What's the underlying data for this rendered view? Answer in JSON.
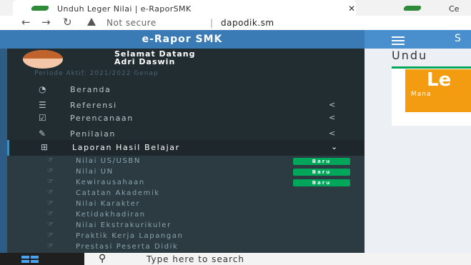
{
  "browser": {
    "tab_title": "Unduh Leger Nilai | e-RaporSMK",
    "tab_close": "✕",
    "tab2_title": "Ce",
    "url_status": "Not secure",
    "url_separator": "|",
    "url_host": "dapodik.sm"
  },
  "app": {
    "brand": "e-Rapor SMK",
    "welcome_line1": "Selamat Datang",
    "welcome_line2": "Adri Daswin",
    "periode": "Periode Aktif: 2021/2022 Genap",
    "topbar_partial": "S"
  },
  "menu": [
    {
      "icon": "dashboard-icon",
      "label": "Beranda",
      "arrow": ""
    },
    {
      "icon": "list-icon",
      "label": "Referensi",
      "arrow": "<"
    },
    {
      "icon": "check-square-icon",
      "label": "Perencanaan",
      "arrow": "<"
    },
    {
      "icon": "edit-icon",
      "label": "Penilaian",
      "arrow": "<"
    },
    {
      "icon": "sitemap-icon",
      "label": "Laporan Hasil Belajar",
      "arrow": "⌄"
    }
  ],
  "submenu": [
    {
      "label": "Nilai US/USBN",
      "badge": "Baru"
    },
    {
      "label": "Nilai UN",
      "badge": "Baru"
    },
    {
      "label": "Kewirausahaan",
      "badge": "Baru"
    },
    {
      "label": "Catatan Akademik",
      "badge": ""
    },
    {
      "label": "Nilai Karakter",
      "badge": ""
    },
    {
      "label": "Ketidakhadiran",
      "badge": ""
    },
    {
      "label": "Nilai Ekstrakurikuler",
      "badge": ""
    },
    {
      "label": "Praktik Kerja Lapangan",
      "badge": ""
    },
    {
      "label": "Prestasi Peserta Didik",
      "badge": ""
    }
  ],
  "content": {
    "title": "Undu",
    "box_big": "Le",
    "box_small": "Mana"
  },
  "taskbar": {
    "search_placeholder": "Type here to search"
  },
  "colors": {
    "brand_blue": "#3a7ab5",
    "sidebar_dark": "#222d32",
    "badge_green": "#00a65a",
    "orange": "#f39c12"
  }
}
